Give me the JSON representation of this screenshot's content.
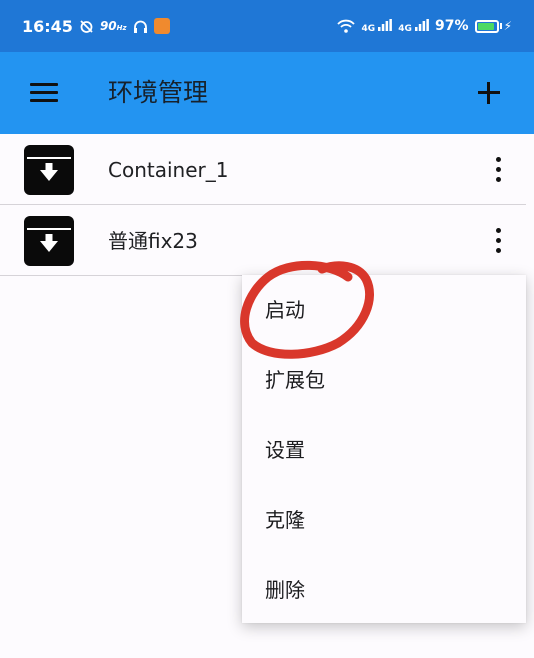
{
  "status_bar": {
    "time": "16:45",
    "speed_value": "90",
    "speed_unit": "Hz",
    "signal_1": "4G",
    "signal_2": "4G",
    "battery": "97%",
    "battery_level_percent": 97
  },
  "app_bar": {
    "title": "环境管理"
  },
  "containers": [
    {
      "name": "Container_1"
    },
    {
      "name": "普通fix23"
    }
  ],
  "popup_menu": {
    "items": [
      {
        "label": "启动"
      },
      {
        "label": "扩展包"
      },
      {
        "label": "设置"
      },
      {
        "label": "克隆"
      },
      {
        "label": "删除"
      }
    ]
  },
  "colors": {
    "status_bar": "#1f77d6",
    "app_bar": "#2394f1",
    "annotation": "#d9372b",
    "battery": "#4cd964"
  },
  "icons": {
    "menu": "hamburger-menu-icon",
    "add": "plus-icon",
    "container": "archive-box-download-icon",
    "overflow": "more-vertical-icon"
  }
}
